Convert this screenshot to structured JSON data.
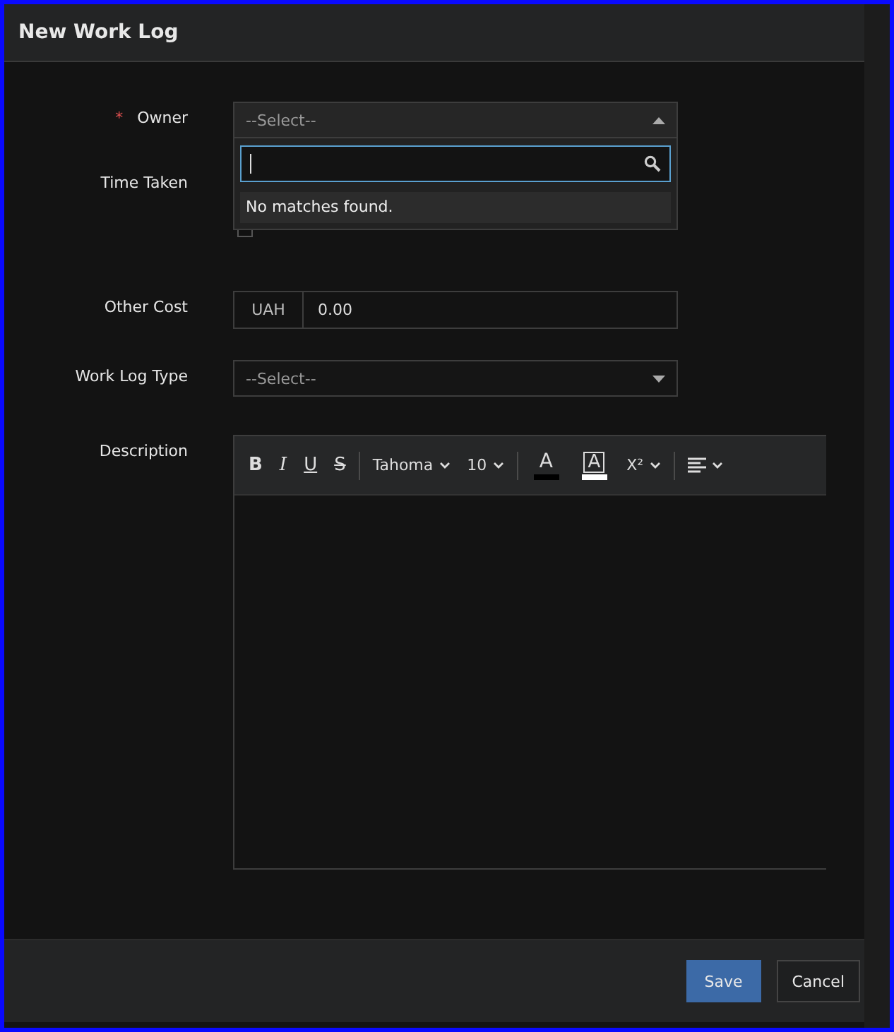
{
  "window": {
    "title": "New Work Log"
  },
  "owner": {
    "label": "Owner",
    "required_mark": "*",
    "placeholder": "--Select--",
    "expanded": true,
    "empty_message": "No matches found."
  },
  "time_taken": {
    "label": "Time Taken",
    "checked": false
  },
  "other_cost": {
    "label": "Other Cost",
    "currency": "UAH",
    "value": "0.00"
  },
  "work_log_type": {
    "label": "Work Log Type",
    "placeholder": "--Select--",
    "expanded": false
  },
  "description": {
    "label": "Description",
    "toolbar": [
      {
        "kind": "bold",
        "text": "B"
      },
      {
        "kind": "italic",
        "text": "I"
      },
      {
        "kind": "underline",
        "text": "U"
      },
      {
        "kind": "strike",
        "text": "S"
      },
      {
        "kind": "sep"
      },
      {
        "kind": "dropdown",
        "text": "Tahoma"
      },
      {
        "kind": "dropdown",
        "text": "10"
      },
      {
        "kind": "sep"
      },
      {
        "kind": "forecolor",
        "text": "A",
        "color": "#000000"
      },
      {
        "kind": "backcolor",
        "text": "A",
        "color": "#ffffff"
      },
      {
        "kind": "dropdown",
        "text": "X²"
      },
      {
        "kind": "sep"
      },
      {
        "kind": "align"
      }
    ]
  },
  "buttons": [
    {
      "kind": "primary",
      "label": "Save"
    },
    {
      "kind": "secondary",
      "label": "Cancel"
    }
  ]
}
